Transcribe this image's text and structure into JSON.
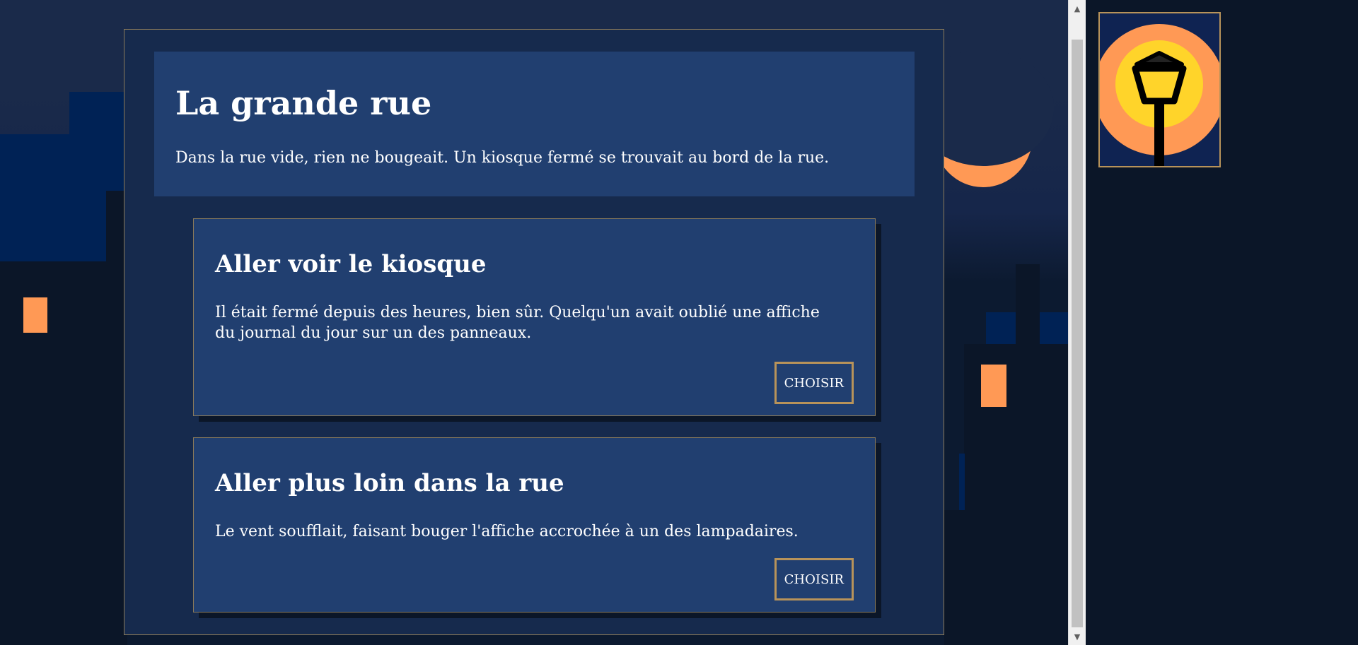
{
  "story": {
    "title": "La grande rue",
    "description": "Dans la rue vide, rien ne bougeait. Un kiosque fermé se trouvait au bord de la rue."
  },
  "choices": [
    {
      "title": "Aller voir le kiosque",
      "text": "Il était fermé depuis des heures, bien sûr. Quelqu'un avait oublié une affiche du journal du jour sur un des panneaux.",
      "button_label": "CHOISIR"
    },
    {
      "title": "Aller plus loin dans la rue",
      "text": "Le vent soufflait, faisant bouger l'affiche accrochée à un des lampadaires.",
      "button_label": "CHOISIR"
    }
  ],
  "colors": {
    "panel_bg": "#162a4d",
    "card_bg": "#213f70",
    "accent_border": "#b8935a",
    "light_orange": "#ff9955",
    "lamp_yellow": "#ffd42a"
  },
  "icons": {
    "side_illustration": "street-lamp-icon",
    "scroll_up": "chevron-up-icon",
    "scroll_down": "chevron-down-icon"
  }
}
